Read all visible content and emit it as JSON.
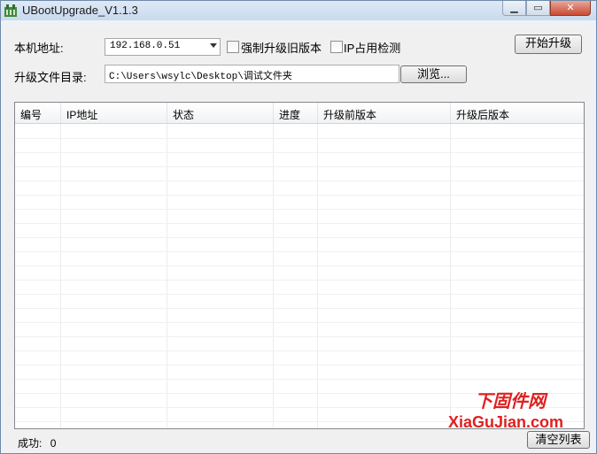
{
  "window": {
    "title": "UBootUpgrade_V1.1.3",
    "caption_glyphs": {
      "minimize": "▁",
      "maximize": "▭",
      "close": "✕"
    }
  },
  "form": {
    "local_address_label": "本机地址:",
    "local_address_value": "192.168.0.51",
    "force_old_version_label": "强制升级旧版本",
    "ip_in_use_check_label": "IP占用检测",
    "start_upgrade_button": "开始升级",
    "upgrade_dir_label": "升级文件目录:",
    "upgrade_dir_value": "C:\\Users\\wsylc\\Desktop\\调试文件夹",
    "browse_button": "浏览..."
  },
  "table": {
    "columns": [
      "编号",
      "IP地址",
      "状态",
      "进度",
      "升级前版本",
      "升级后版本"
    ],
    "rows": []
  },
  "footer": {
    "success_label": "成功:",
    "success_count": "0",
    "clear_list_button": "清空列表"
  },
  "watermark": {
    "top_text": "下固件网",
    "bottom_text": "XiaGuJian.com"
  },
  "colors": {
    "watermark": "#e02020",
    "title_bar": "#c9daee"
  }
}
